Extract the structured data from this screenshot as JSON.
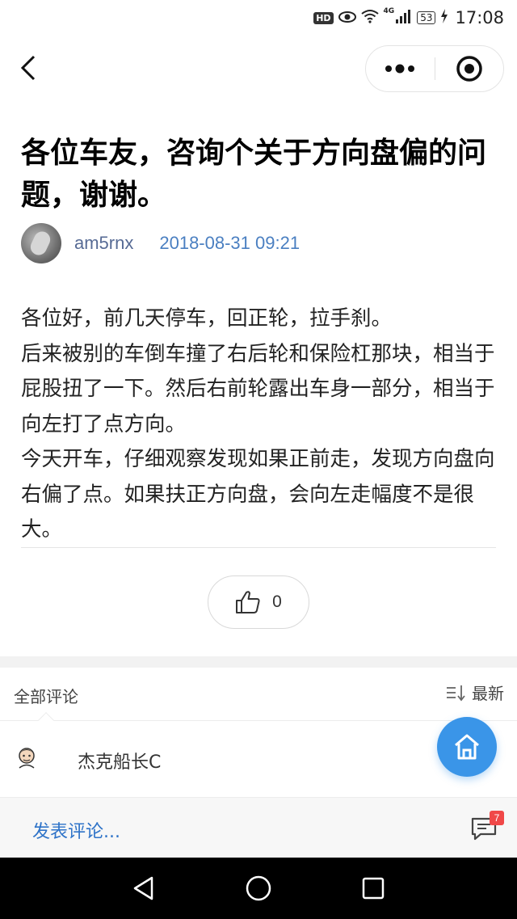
{
  "status_bar": {
    "hd_label": "HD",
    "network_label": "4G",
    "battery_level": "53",
    "time": "17:08",
    "icons": [
      "hd-icon",
      "eye-icon",
      "wifi-icon",
      "signal-icon",
      "battery-icon",
      "charging-icon"
    ]
  },
  "navbar": {
    "back_icon": "chevron-left-icon",
    "more_icon": "more-dots-icon",
    "close_icon": "target-close-icon"
  },
  "post": {
    "title": "各位车友，咨询个关于方向盘偏的问题，谢谢。",
    "author": "am5rnx",
    "date": "2018-08-31 09:21",
    "body": [
      "各位好，前几天停车，回正轮，拉手刹。",
      "后来被别的车倒车撞了右后轮和保险杠那块，相当于屁股扭了一下。然后右前轮露出车身一部分，相当于向左打了点方向。",
      "今天开车，仔细观察发现如果正前走，发现方向盘向右偏了点。如果扶正方向盘，会向左走幅度不是很大。"
    ]
  },
  "like": {
    "icon": "thumbs-up-icon",
    "count": "0"
  },
  "comments": {
    "header_title": "全部评论",
    "sort_label": "最新",
    "sort_icon": "sort-icon",
    "items": [
      {
        "user": "杰克船长C",
        "avatar_icon": "cartoon-avatar-icon"
      }
    ]
  },
  "fab": {
    "icon": "home-icon",
    "color": "#3a95e8"
  },
  "bottom_bar": {
    "post_comment_label": "发表评论...",
    "comment_icon": "comment-icon",
    "badge_count": "7"
  },
  "android_nav": {
    "back_icon": "triangle-back-icon",
    "home_icon": "circle-home-icon",
    "recents_icon": "square-recents-icon"
  },
  "colors": {
    "link_blue": "#576b95",
    "date_blue": "#4a7fc1",
    "post_comment_blue": "#2e73c8",
    "badge_red": "#f04848"
  }
}
